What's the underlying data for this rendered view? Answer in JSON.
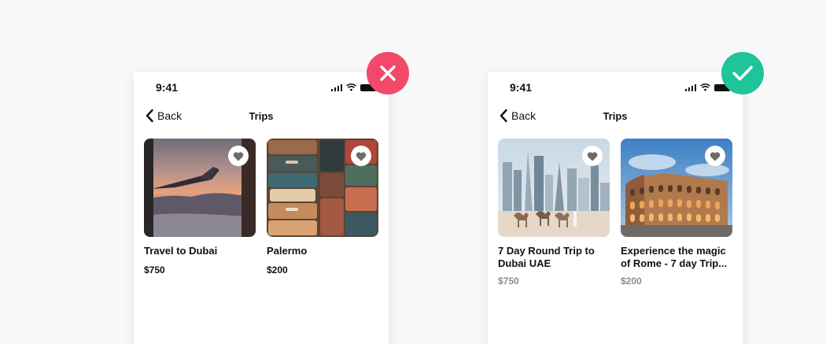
{
  "colors": {
    "bad": "#f2496b",
    "good": "#1fc499",
    "price_muted": "#8b8b8b"
  },
  "icons": {
    "bad": "close-icon",
    "good": "check-icon",
    "fav": "heart-icon",
    "back": "chevron-left-icon"
  },
  "bad_example": {
    "status_time": "9:41",
    "back_label": "Back",
    "title": "Trips",
    "cards": [
      {
        "title": "Travel to Dubai",
        "price": "$750",
        "image": "airplane-window-sunset"
      },
      {
        "title": "Palermo",
        "price": "$200",
        "image": "stacked-suitcases"
      }
    ]
  },
  "good_example": {
    "status_time": "9:41",
    "back_label": "Back",
    "title": "Trips",
    "cards": [
      {
        "title": "7 Day Round Trip to Dubai UAE",
        "price": "$750",
        "image": "dubai-skyline-camels"
      },
      {
        "title": "Experience the magic of Rome - 7 day Trip...",
        "price": "$200",
        "image": "rome-colosseum"
      }
    ]
  }
}
